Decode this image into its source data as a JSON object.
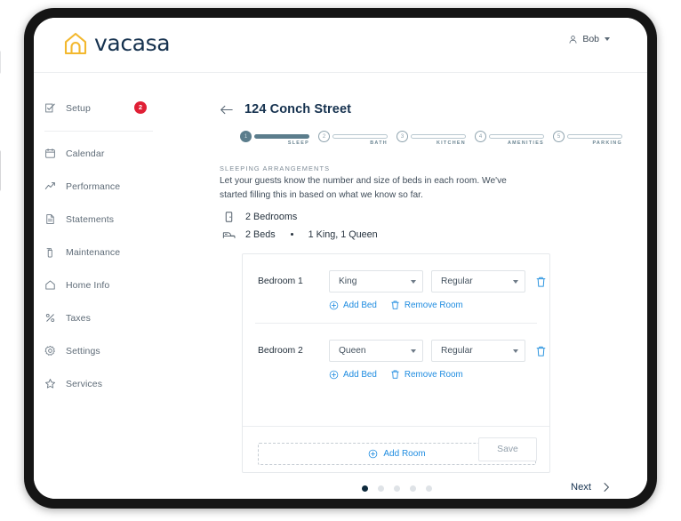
{
  "brand": {
    "name": "vacasa",
    "logo_icon": "house-icon",
    "logo_icon_color": "#f3b82e",
    "logo_text_color": "#16324f"
  },
  "accent": {
    "link": "#1f8ce0",
    "badge": "#e01f35",
    "step_done": "#5b7d8c",
    "dark": "#16324f"
  },
  "topbar": {
    "user": {
      "name": "Bob",
      "icon": "user-icon",
      "caret": "chevron-down-icon"
    }
  },
  "sidebar": {
    "primary": {
      "label": "Setup",
      "icon": "checklist-icon",
      "badge": "2"
    },
    "items": [
      {
        "label": "Calendar",
        "icon": "calendar-icon"
      },
      {
        "label": "Performance",
        "icon": "trending-up-icon"
      },
      {
        "label": "Statements",
        "icon": "document-icon"
      },
      {
        "label": "Maintenance",
        "icon": "spray-bottle-icon"
      },
      {
        "label": "Home Info",
        "icon": "home-icon"
      },
      {
        "label": "Taxes",
        "icon": "percent-icon"
      },
      {
        "label": "Settings",
        "icon": "gear-icon"
      },
      {
        "label": "Services",
        "icon": "star-icon"
      }
    ]
  },
  "main": {
    "back_icon": "arrow-left-icon",
    "title": "124 Conch Street",
    "steps": [
      {
        "num": "1",
        "label": "SLEEP",
        "state": "done"
      },
      {
        "num": "2",
        "label": "BATH",
        "state": "todo"
      },
      {
        "num": "3",
        "label": "KITCHEN",
        "state": "todo"
      },
      {
        "num": "4",
        "label": "AMENITIES",
        "state": "todo"
      },
      {
        "num": "5",
        "label": "PARKING",
        "state": "todo"
      }
    ],
    "section": {
      "eyebrow": "SLEEPING ARRANGEMENTS",
      "description": "Let your guests know the number and size of beds in each room. We've started filling this in based on what we know so far."
    },
    "summary": [
      {
        "icon": "door-icon",
        "text": "2 Bedrooms"
      },
      {
        "icon": "bed-icon",
        "text_a": "2 Beds",
        "text_b": "1 King, 1 Queen"
      }
    ],
    "rooms": [
      {
        "name": "Bedroom 1",
        "bed_size": "King",
        "bed_type": "Regular",
        "delete_icon": "trash-icon",
        "add_bed_label": "Add Bed",
        "add_bed_icon": "plus-circle-icon",
        "remove_room_label": "Remove Room",
        "remove_room_icon": "trash-icon"
      },
      {
        "name": "Bedroom 2",
        "bed_size": "Queen",
        "bed_type": "Regular",
        "delete_icon": "trash-icon",
        "add_bed_label": "Add Bed",
        "add_bed_icon": "plus-circle-icon",
        "remove_room_label": "Remove Room",
        "remove_room_icon": "trash-icon"
      }
    ],
    "add_room": {
      "label": "Add Room",
      "icon": "plus-circle-icon"
    },
    "save_label": "Save",
    "pagination": {
      "total": 5,
      "active_index": 0
    },
    "next": {
      "label": "Next",
      "icon": "chevron-right-icon"
    }
  }
}
